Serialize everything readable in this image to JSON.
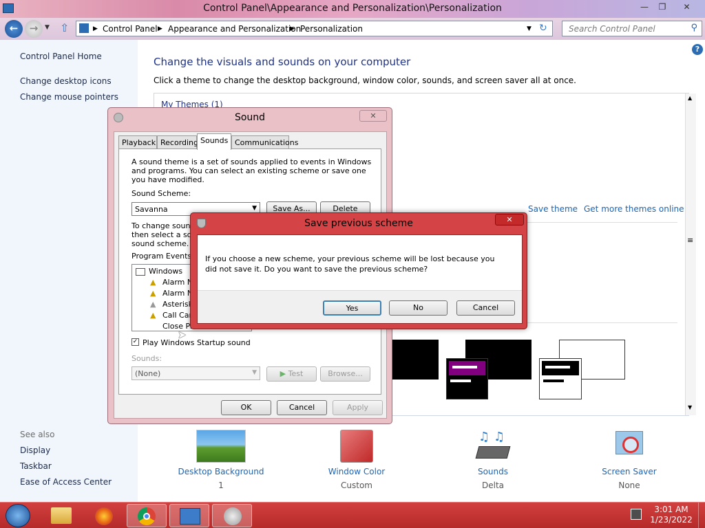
{
  "window": {
    "title": "Control Panel\\Appearance and Personalization\\Personalization"
  },
  "address": {
    "crumbs": [
      "Control Panel",
      "Appearance and Personalization",
      "Personalization"
    ],
    "search_placeholder": "Search Control Panel"
  },
  "leftnav": {
    "home": "Control Panel Home",
    "links": [
      "Change desktop icons",
      "Change mouse pointers"
    ],
    "see_also_label": "See also",
    "see_also": [
      "Display",
      "Taskbar",
      "Ease of Access Center"
    ]
  },
  "main": {
    "heading": "Change the visuals and sounds on your computer",
    "subheading": "Click a theme to change the desktop background, window color, sounds, and screen saver all at once.",
    "my_themes": "My Themes (1)",
    "save_theme": "Save theme",
    "get_more": "Get more themes online",
    "tiles": [
      {
        "label": "Desktop Background",
        "sub": "1"
      },
      {
        "label": "Window Color",
        "sub": "Custom"
      },
      {
        "label": "Sounds",
        "sub": "Delta"
      },
      {
        "label": "Screen Saver",
        "sub": "None"
      }
    ]
  },
  "sound_dialog": {
    "title": "Sound",
    "tabs": [
      "Playback",
      "Recording",
      "Sounds",
      "Communications"
    ],
    "description": "A sound theme is a set of sounds applied to events in Windows and programs.  You can select an existing scheme or save one you have modified.",
    "scheme_label": "Sound Scheme:",
    "scheme_value": "Savanna",
    "save_as": "Save As...",
    "delete": "Delete",
    "change_text_1": "To change sound",
    "change_text_2": "then select a sou",
    "change_text_3": "sound scheme.",
    "events_label": "Program Events:",
    "events": [
      "Windows",
      "Alarm No",
      "Alarm No",
      "Asterisk",
      "Call Can",
      "Close Pr"
    ],
    "startup_checkbox": "Play Windows Startup sound",
    "sounds_label": "Sounds:",
    "sounds_value": "(None)",
    "test": "Test",
    "browse": "Browse...",
    "ok": "OK",
    "cancel": "Cancel",
    "apply": "Apply"
  },
  "save_dialog": {
    "title": "Save previous scheme",
    "message": "If you choose a new scheme, your previous scheme will be lost because you did not save it. Do you want to save the previous scheme?",
    "yes": "Yes",
    "no": "No",
    "cancel": "Cancel"
  },
  "taskbar": {
    "time": "3:01 AM",
    "date": "1/23/2022"
  },
  "colors": {
    "link": "#1b64b4",
    "heading": "#1e3287",
    "taskbar": "#c03434",
    "dialog_frame": "#d44446"
  }
}
